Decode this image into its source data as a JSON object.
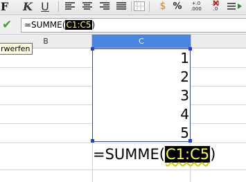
{
  "toolbar": {
    "bold_label": "F",
    "italic_label": "K",
    "underline_label": "U",
    "currency_label": "$",
    "percent_label": "%",
    "add_decimal_label": "+.0\n.000",
    "remove_decimal_label": ".00\n.0"
  },
  "formula_bar": {
    "formula_prefix": "=SUMME(",
    "formula_ref": "C1:C5",
    "formula_suffix": ")"
  },
  "column_headers": {
    "b": "B",
    "c": "C"
  },
  "tooltip": "rwerfen",
  "cells": [
    "1",
    "2",
    "3",
    "4",
    "5"
  ],
  "in_cell_formula": {
    "prefix": "=SUMME(",
    "ref": "C1:C5",
    "suffix": ")"
  },
  "colors": {
    "selected_column_header": "#4a86e0",
    "range_border": "#2b44c8",
    "ref_highlight_bg": "#000000",
    "ref_highlight_text": "#ffff33",
    "accept_check": "#3ca12e"
  }
}
